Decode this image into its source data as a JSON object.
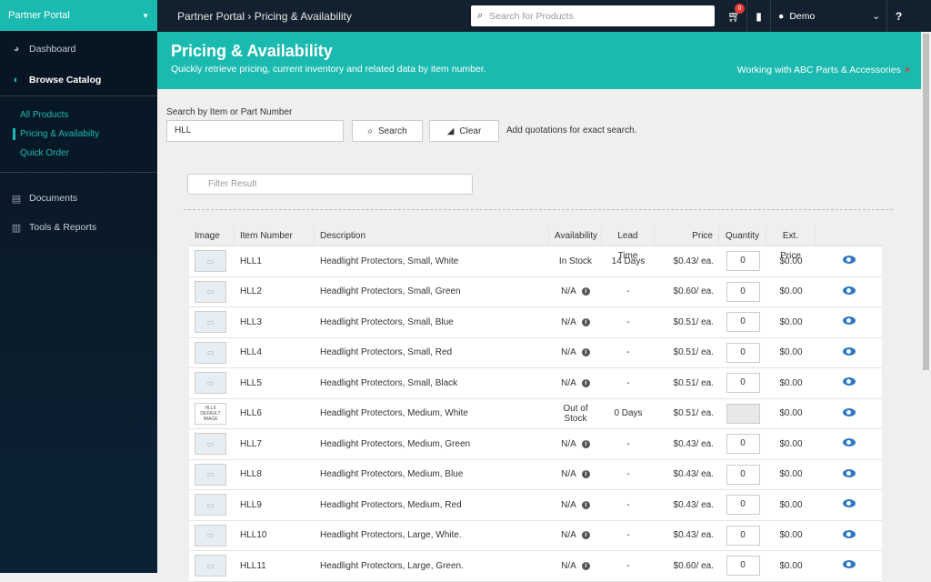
{
  "sidebar": {
    "brand": "Partner Portal",
    "items": [
      {
        "label": "Dashboard",
        "icon": "dashboard-icon"
      },
      {
        "label": "Browse Catalog",
        "icon": "catalog-icon"
      },
      {
        "label": "Documents",
        "icon": "document-icon"
      },
      {
        "label": "Tools & Reports",
        "icon": "chart-icon"
      }
    ],
    "subitems": [
      "All Products",
      "Pricing & Availabilty",
      "Quick Order"
    ]
  },
  "topbar": {
    "breadcrumb": "Partner Portal › Pricing & Availability",
    "search_placeholder": "Search for Products",
    "cart_count": "0",
    "user": "Demo",
    "help": "?"
  },
  "banner": {
    "title": "Pricing & Availability",
    "subtitle": "Quickly retrieve pricing, current inventory and related data by item number.",
    "working": "Working with ABC Parts & Accessories",
    "close": "×"
  },
  "search": {
    "label": "Search by Item or Part Number",
    "value": "HLL",
    "search_button": "Search",
    "clear_button": "Clear",
    "hint": "Add quotations for exact search.",
    "filter_placeholder": "Filter Result"
  },
  "table": {
    "headers": [
      "Image",
      "Item Number",
      "Description",
      "Availability",
      "Lead Time",
      "Price",
      "Quantity",
      "Ext. Price",
      ""
    ],
    "default_image_text": "HLL6 DEFAULT IMAGE",
    "rows": [
      {
        "item": "HLL1",
        "desc": "Headlight Protectors, Small, White",
        "avail": "In Stock",
        "info": false,
        "lead": "14 Days",
        "price": "$0.43/ ea.",
        "qty": "0",
        "ext": "$0.00"
      },
      {
        "item": "HLL2",
        "desc": "Headlight Protectors, Small, Green",
        "avail": "N/A",
        "info": true,
        "lead": "-",
        "price": "$0.60/ ea.",
        "qty": "0",
        "ext": "$0.00"
      },
      {
        "item": "HLL3",
        "desc": "Headlight Protectors, Small, Blue",
        "avail": "N/A",
        "info": true,
        "lead": "-",
        "price": "$0.51/ ea.",
        "qty": "0",
        "ext": "$0.00"
      },
      {
        "item": "HLL4",
        "desc": "Headlight Protectors, Small, Red",
        "avail": "N/A",
        "info": true,
        "lead": "-",
        "price": "$0.51/ ea.",
        "qty": "0",
        "ext": "$0.00"
      },
      {
        "item": "HLL5",
        "desc": "Headlight Protectors, Small, Black",
        "avail": "N/A",
        "info": true,
        "lead": "-",
        "price": "$0.51/ ea.",
        "qty": "0",
        "ext": "$0.00"
      },
      {
        "item": "HLL6",
        "desc": "Headlight Protectors, Medium, White",
        "avail": "Out of Stock",
        "info": false,
        "lead": "0 Days",
        "price": "$0.51/ ea.",
        "qty": "",
        "ext": "$0.00",
        "default_img": true,
        "disabled": true
      },
      {
        "item": "HLL7",
        "desc": "Headlight Protectors, Medium, Green",
        "avail": "N/A",
        "info": true,
        "lead": "-",
        "price": "$0.43/ ea.",
        "qty": "0",
        "ext": "$0.00"
      },
      {
        "item": "HLL8",
        "desc": "Headlight Protectors, Medium, Blue",
        "avail": "N/A",
        "info": true,
        "lead": "-",
        "price": "$0.43/ ea.",
        "qty": "0",
        "ext": "$0.00"
      },
      {
        "item": "HLL9",
        "desc": "Headlight Protectors, Medium, Red",
        "avail": "N/A",
        "info": true,
        "lead": "-",
        "price": "$0.43/ ea.",
        "qty": "0",
        "ext": "$0.00"
      },
      {
        "item": "HLL10",
        "desc": "Headlight Protectors, Large, White.",
        "avail": "N/A",
        "info": true,
        "lead": "-",
        "price": "$0.43/ ea.",
        "qty": "0",
        "ext": "$0.00"
      },
      {
        "item": "HLL11",
        "desc": "Headlight Protectors, Large, Green.",
        "avail": "N/A",
        "info": true,
        "lead": "-",
        "price": "$0.60/ ea.",
        "qty": "0",
        "ext": "$0.00"
      }
    ]
  },
  "colors": {
    "accent": "#1abab0",
    "sidebar": "#0b1d2d",
    "topbar": "#13212e",
    "eye": "#2f77c0",
    "alert": "#e53935"
  }
}
